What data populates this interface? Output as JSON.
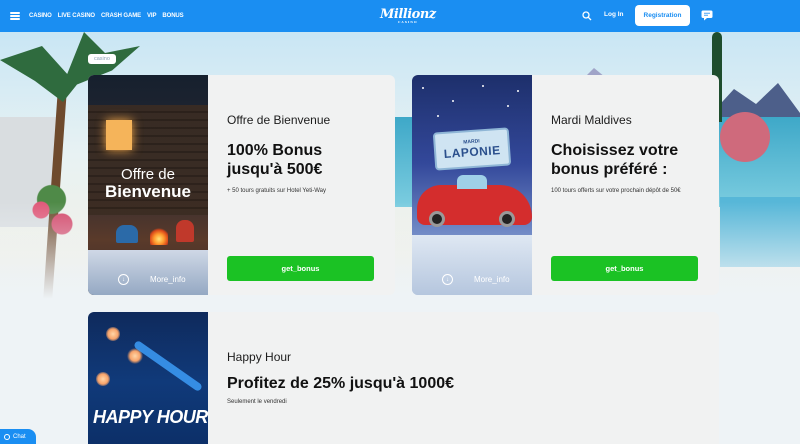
{
  "header": {
    "nav": [
      "CASINO",
      "LIVE CASINO",
      "CRASH GAME",
      "VIP",
      "BONUS"
    ],
    "logo": "Millionz",
    "logo_sub": "CASINO",
    "login": "Log In",
    "register": "Registration"
  },
  "breadcrumb": "casino",
  "cards": [
    {
      "image_title_line1": "Offre de",
      "image_title_line2": "Bienvenue",
      "more_info": "More_info",
      "title": "Offre de Bienvenue",
      "headline": "100% Bonus jusqu'à 500€",
      "description": "+ 50 tours gratuits sur Hotel Yeti-Way",
      "button": "get_bonus"
    },
    {
      "image_sign_line1": "MARDI",
      "image_sign_line2": "LAPONIE",
      "more_info": "More_info",
      "title": "Mardi Maldives",
      "headline": "Choisissez votre bonus préféré :",
      "description": "100 tours offerts sur votre prochain dépôt de 50€",
      "button": "get_bonus"
    },
    {
      "image_title": "HAPPY HOUR",
      "title": "Happy Hour",
      "headline": "Profitez de 25% jusqu'à 1000€",
      "description": "Seulement le vendredi"
    }
  ],
  "chat_widget": "Chat",
  "colors": {
    "header_blue": "#1a8ef2",
    "button_green": "#1bc224",
    "card_bg": "#f1f2f2"
  }
}
